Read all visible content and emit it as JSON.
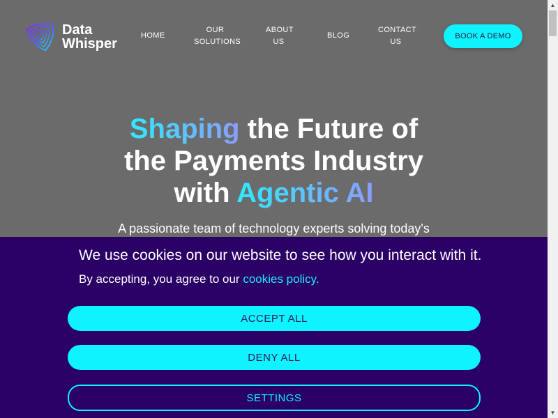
{
  "brand": {
    "line1": "Data",
    "line2": "Whisper"
  },
  "nav": {
    "home": "HOME",
    "solutions_1": "OUR",
    "solutions_2": "SOLUTIONS",
    "about_1": "ABOUT",
    "about_2": "US",
    "blog": "BLOG",
    "contact_1": "CONTACT",
    "contact_2": "US",
    "cta": "BOOK A DEMO"
  },
  "hero": {
    "w1": "Shaping",
    "w2": " the Future of",
    "w3": "the Payments Industry",
    "w4": "with ",
    "w5": "Agentic AI",
    "subtitle": "A passionate team of technology experts solving today's"
  },
  "cookie": {
    "title": "We use cookies on our website to see how you interact with it.",
    "text": "By accepting, you agree to our ",
    "link": "cookies policy.",
    "accept": "ACCEPT ALL",
    "deny": "DENY ALL",
    "settings": "SETTINGS"
  },
  "colors": {
    "accent": "#0ff2ff",
    "banner": "#2b0066",
    "hero_bg": "#6b6b6b"
  },
  "icons": {
    "logo": "data-whisper-logo-icon",
    "scroll_up": "scroll-up-arrow-icon",
    "scroll_down": "scroll-down-arrow-icon"
  }
}
